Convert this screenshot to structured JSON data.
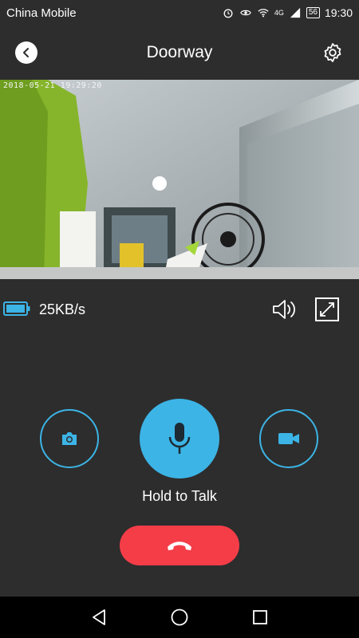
{
  "status_bar": {
    "carrier": "China Mobile",
    "network": "4G",
    "battery": "56",
    "time": "19:30"
  },
  "header": {
    "title": "Doorway"
  },
  "camera": {
    "timestamp": "2018-05-21  19:29:20"
  },
  "stream": {
    "rate": "25KB/s"
  },
  "actions": {
    "talk_label": "Hold to Talk"
  },
  "colors": {
    "accent": "#3cb4e6",
    "hangup": "#f53d48",
    "background": "#2d2d2d"
  }
}
